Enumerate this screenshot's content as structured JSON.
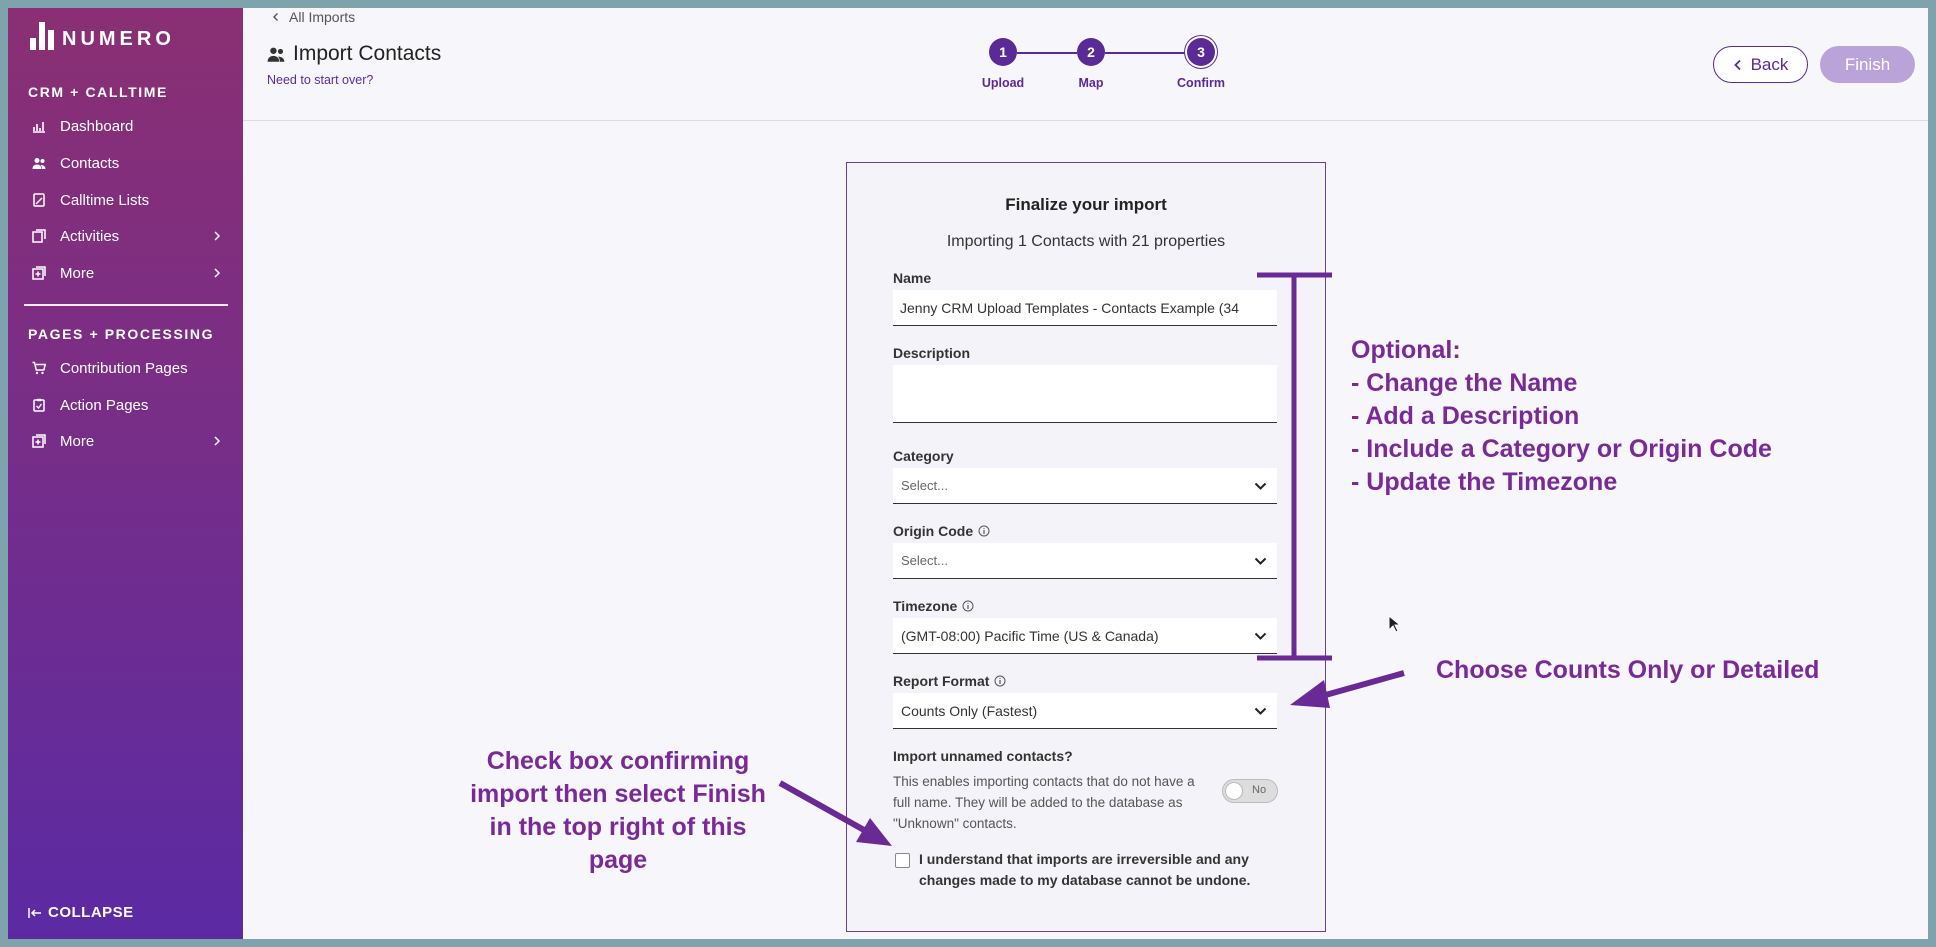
{
  "sidebar": {
    "brand": "NUMERO",
    "sections": [
      {
        "title": "CRM + CALLTIME"
      },
      {
        "title": "PAGES + PROCESSING"
      }
    ],
    "crm_items": [
      {
        "label": "Dashboard",
        "icon": "chart-icon"
      },
      {
        "label": "Contacts",
        "icon": "people-icon"
      },
      {
        "label": "Calltime Lists",
        "icon": "phone-list-icon"
      },
      {
        "label": "Activities",
        "icon": "activities-icon"
      },
      {
        "label": "More",
        "icon": "more-icon"
      }
    ],
    "pages_items": [
      {
        "label": "Contribution Pages",
        "icon": "cart-icon"
      },
      {
        "label": "Action Pages",
        "icon": "clipboard-icon"
      },
      {
        "label": "More",
        "icon": "more-icon"
      }
    ],
    "collapse_label": "COLLAPSE"
  },
  "header": {
    "back_link": "All Imports",
    "title": "Import Contacts",
    "restart_link": "Need to start over?",
    "steps": [
      {
        "number": "1",
        "label": "Upload"
      },
      {
        "number": "2",
        "label": "Map"
      },
      {
        "number": "3",
        "label": "Confirm"
      }
    ],
    "back_button": "Back",
    "finish_button": "Finish"
  },
  "card": {
    "title": "Finalize your import",
    "subtitle": "Importing 1 Contacts with 21 properties",
    "name_label": "Name",
    "name_value": "Jenny CRM Upload Templates - Contacts Example (34",
    "description_label": "Description",
    "description_value": "",
    "category_label": "Category",
    "category_value": "Select...",
    "origin_code_label": "Origin Code",
    "origin_code_value": "Select...",
    "timezone_label": "Timezone",
    "timezone_value": "(GMT-08:00) Pacific Time (US & Canada)",
    "report_format_label": "Report Format",
    "report_format_value": "Counts Only (Fastest)",
    "unnamed_label": "Import unnamed contacts?",
    "unnamed_description": "This enables importing contacts that do not have a full name. They will be added to the database as \"Unknown\" contacts.",
    "unnamed_toggle": "No",
    "confirm_text": "I understand that imports are irreversible and any changes made to my database cannot be undone."
  },
  "annotations": {
    "optional": [
      "Optional:",
      "- Change the Name",
      "- Add a Description",
      "- Include a Category or Origin Code",
      "- Update the Timezone"
    ],
    "report": "Choose Counts Only or Detailed",
    "checkbox": "Check box confirming import then select Finish in the top right of this page"
  },
  "colors": {
    "accent": "#5a2a96",
    "annotation": "#7a2a96",
    "finish_disabled": "#b9a3d8"
  }
}
